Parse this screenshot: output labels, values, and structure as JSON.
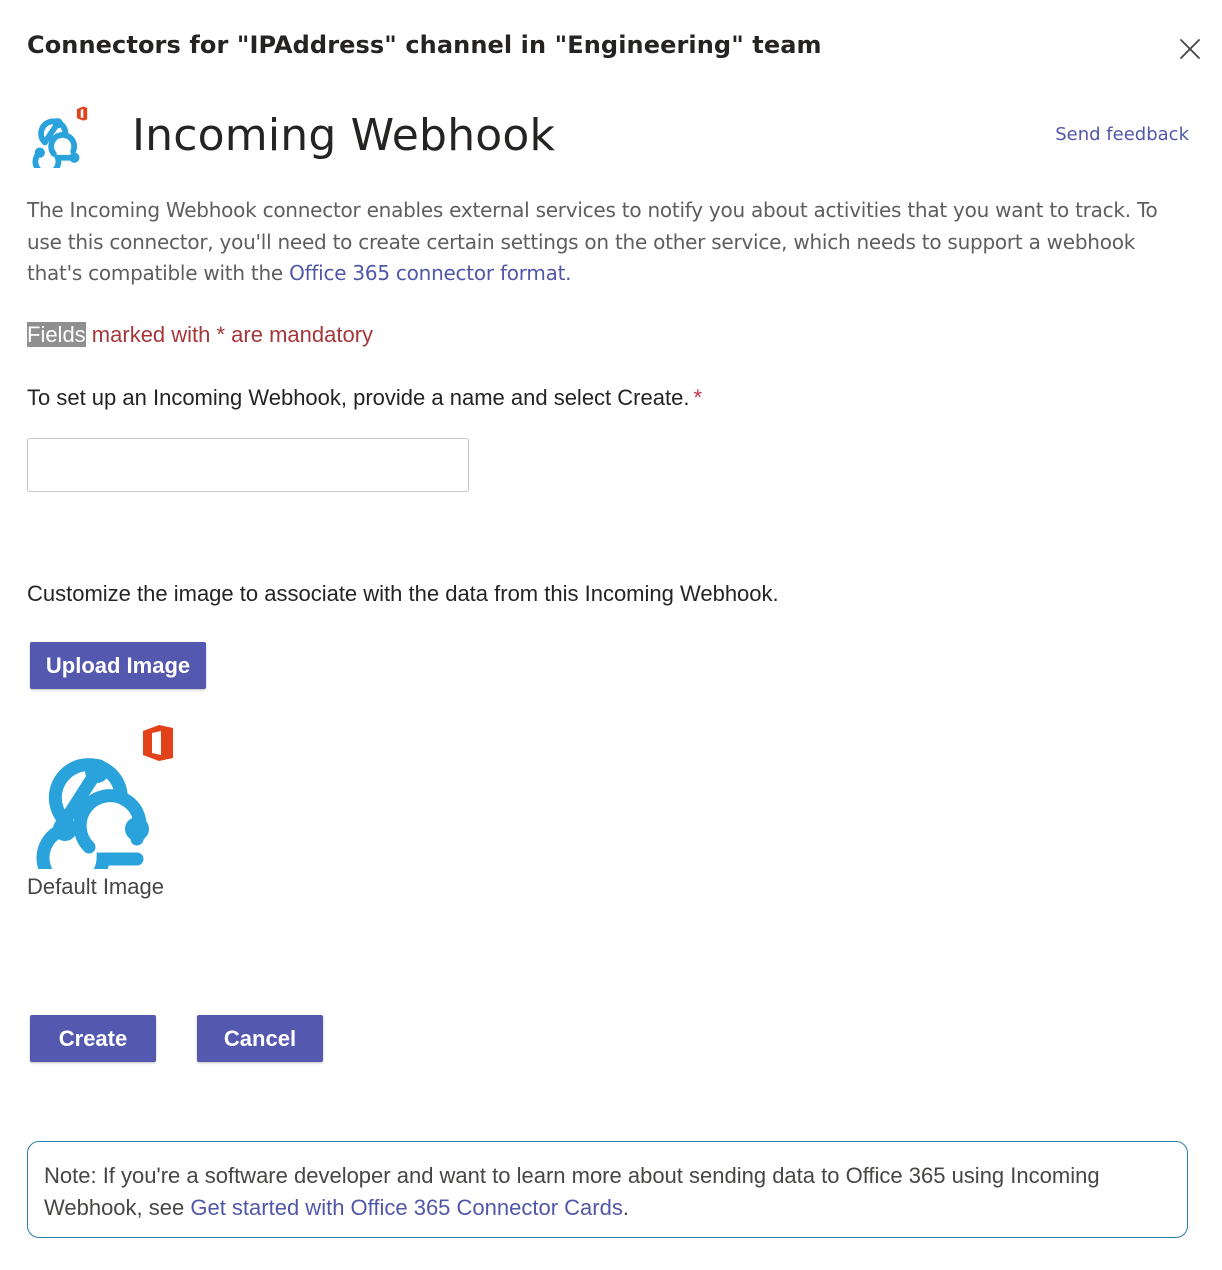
{
  "dialog": {
    "title": "Connectors for \"IPAddress\" channel in \"Engineering\" team",
    "close_icon": "close-icon"
  },
  "connector": {
    "name": "Incoming Webhook",
    "logo_icon": "webhook-office-icon",
    "send_feedback": "Send feedback",
    "description_text": "The Incoming Webhook connector enables external services to notify you about activities that you want to track. To use this connector, you'll need to create certain settings on the other service, which needs to support a webhook that's compatible with the ",
    "description_link": "Office 365 connector format.",
    "colors": {
      "webhook_blue": "#2aa3dc",
      "office_red": "#e3411a",
      "accent": "#5558af",
      "link": "#5157a8"
    }
  },
  "form": {
    "mandatory_highlight": "Fields",
    "mandatory_rest": " marked with * are mandatory",
    "name_label": "To set up an Incoming Webhook, provide a name and select Create.",
    "required_marker": "*",
    "name_value": "",
    "customize_label": "Customize the image to associate with the data from this Incoming Webhook.",
    "upload_button": "Upload Image",
    "default_image_caption": "Default Image"
  },
  "actions": {
    "create": "Create",
    "cancel": "Cancel"
  },
  "note": {
    "text": "Note: If you're a software developer and want to learn more about sending data to Office 365 using Incoming Webhook, see ",
    "link": "Get started with Office 365 Connector Cards",
    "suffix": "."
  }
}
